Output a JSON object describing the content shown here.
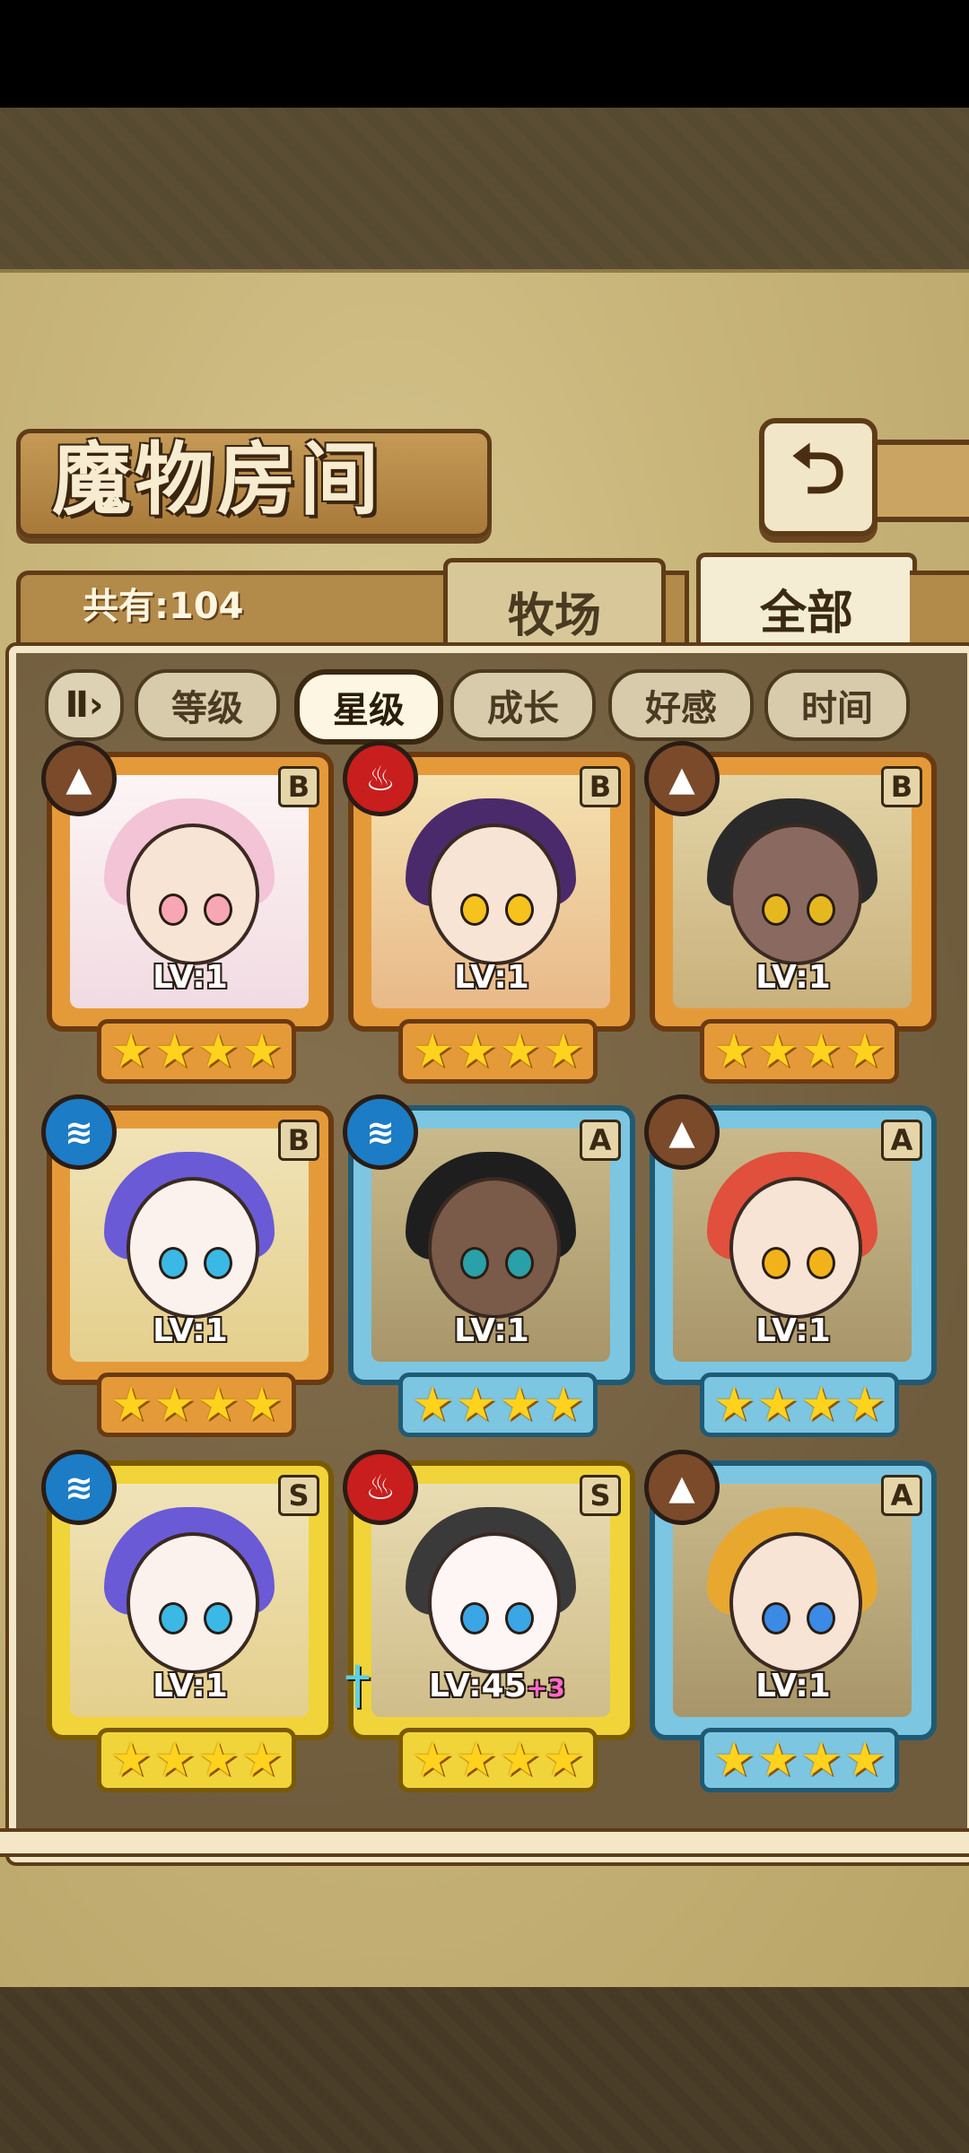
{
  "title": "魔物房间",
  "back_icon": "back-arrow-icon",
  "count_label": "共有:104",
  "tabs": [
    {
      "label": "牧场",
      "active": false
    },
    {
      "label": "全部",
      "active": true
    }
  ],
  "sort_toggle_icon": "sort-order-icon",
  "sort_buttons": [
    {
      "label": "等级",
      "active": false
    },
    {
      "label": "星级",
      "active": true
    },
    {
      "label": "成长",
      "active": false
    },
    {
      "label": "好感",
      "active": false
    },
    {
      "label": "时间",
      "active": false
    }
  ],
  "colors": {
    "earth": "#7a4a2a",
    "fire": "#c81e1e",
    "water": "#1c7cc6",
    "tier_B": "#e59a3a",
    "tier_A": "#7cc6e2",
    "tier_S": "#f1d43a",
    "star": "#ffd21e"
  },
  "monsters": [
    {
      "element": "earth-icon",
      "rank": "B",
      "level": "LV:1",
      "bonus": "",
      "stars": 4
    },
    {
      "element": "fire-icon",
      "rank": "B",
      "level": "LV:1",
      "bonus": "",
      "stars": 4
    },
    {
      "element": "earth-icon",
      "rank": "B",
      "level": "LV:1",
      "bonus": "",
      "stars": 4
    },
    {
      "element": "water-icon",
      "rank": "B",
      "level": "LV:1",
      "bonus": "",
      "stars": 4
    },
    {
      "element": "water-icon",
      "rank": "A",
      "level": "LV:1",
      "bonus": "",
      "stars": 4
    },
    {
      "element": "earth-icon",
      "rank": "A",
      "level": "LV:1",
      "bonus": "",
      "stars": 4
    },
    {
      "element": "water-icon",
      "rank": "S",
      "level": "LV:1",
      "bonus": "",
      "stars": 4
    },
    {
      "element": "fire-icon",
      "rank": "S",
      "level": "LV:45",
      "bonus": "+3",
      "stars": 4
    },
    {
      "element": "earth-icon",
      "rank": "A",
      "level": "LV:1",
      "bonus": "",
      "stars": 4
    }
  ]
}
